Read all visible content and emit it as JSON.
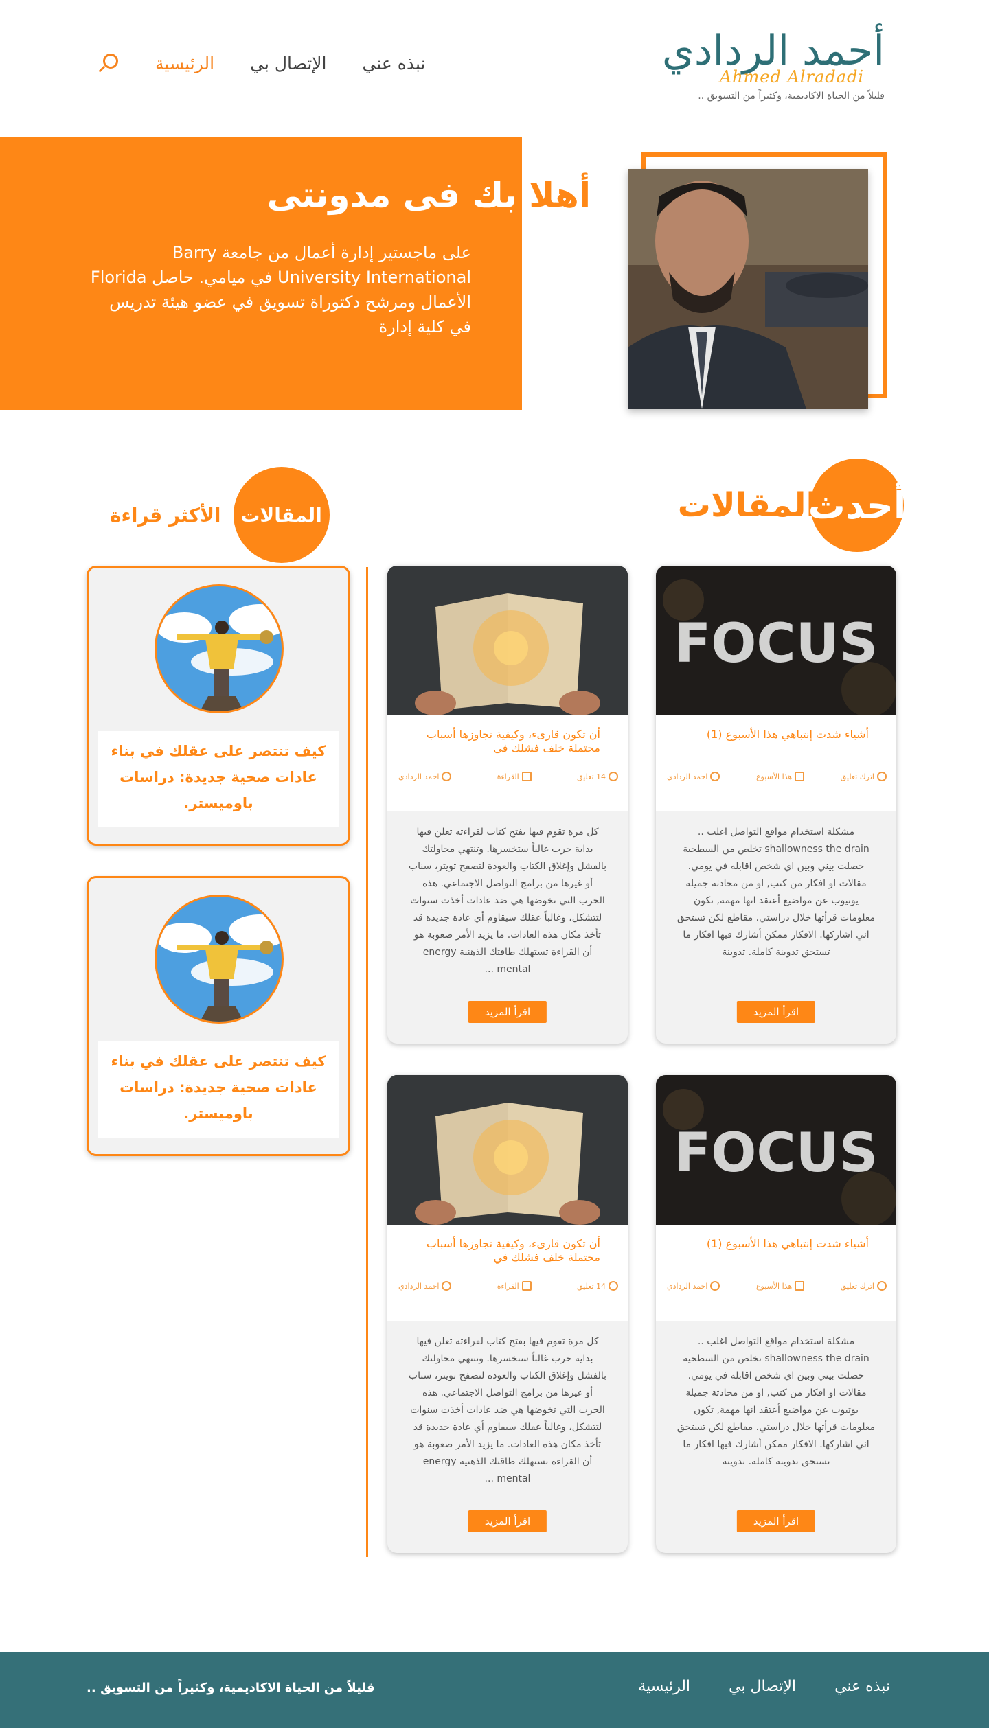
{
  "header": {
    "logo_ar": "أحمد الردادي",
    "logo_en": "Ahmed Alradadi",
    "tagline": "قليلاً من الحياة الاكاديمية، وكثيراً من التسويق .."
  },
  "nav": {
    "home": "الرئيسية",
    "contact": "الإتصال بي",
    "about": "نبذه عني",
    "search_icon": "search-icon"
  },
  "hero": {
    "title_word1": "أهلا",
    "title_rest": "بك فى مدونتى",
    "text": "على ماجستير إدارة أعمال من جامعة Barry University International في ميامي. حاصل Florida الأعمال ومرشح دكتوراة تسويق في عضو هيئة تدريس في كلية إدارة"
  },
  "latest": {
    "word1": "أحدث",
    "word2": "المقالات"
  },
  "popular": {
    "word1": "المقالات",
    "word2": "الأكثر قراءة"
  },
  "articles": [
    {
      "title": "أشياء شدت إنتباهي هذا الأسبوع (1)",
      "comments": "اترك تعليق",
      "category": "هذا الأسبوع",
      "author": "احمد الردادي",
      "excerpt": "مشكلة استخدام مواقع التواصل اغلب .. shallowness the drain تخلص من السطحية حصلت بيني وبين اي شخص اقابله في يومي. مقالات او افكار من كتب, او من محادثة جميلة يوتيوب عن مواضيع أعتقد انها مهمة, تكون معلومات قرأتها خلال دراستي. مقاطع لكن تستحق اني اشاركها. الافكار ممكن أشارك فيها افكار ما تستحق تدوينة كاملة. تدوينة",
      "more": "اقرأ المزيد"
    },
    {
      "title": "أن تكون قارىء، وكيفية تجاوزها أسباب محتملة خلف فشلك في",
      "comments": "14 تعليق",
      "category": "القراءة",
      "author": "احمد الردادي",
      "excerpt": "كل مرة تقوم فيها بفتح كتاب لقراءته تعلن فيها بداية حرب غالباً ستخسرها. وتنتهي محاولتك بالفشل وإغلاق الكتاب والعودة لتصفح تويتر، سناب أو غيرها من برامج التواصل الاجتماعي. هذه الحرب التي تخوضها هي ضد عادات أخذت سنوات لتتشكل، وغالباً عقلك سيقاوم أي عادة جديدة قد تأخذ مكان هذه العادات. ما يزيد الأمر صعوبة هو أن القراءة تستهلك طاقتك الذهنية energy mental ...",
      "more": "اقرأ المزيد"
    },
    {
      "title": "أشياء شدت إنتباهي هذا الأسبوع (1)",
      "comments": "اترك تعليق",
      "category": "هذا الأسبوع",
      "author": "احمد الردادي",
      "excerpt": "مشكلة استخدام مواقع التواصل اغلب .. shallowness the drain تخلص من السطحية حصلت بيني وبين اي شخص اقابله في يومي. مقالات او افكار من كتب, او من محادثة جميلة يوتيوب عن مواضيع أعتقد انها مهمة, تكون معلومات قرأتها خلال دراستي. مقاطع لكن تستحق اني اشاركها. الافكار ممكن أشارك فيها افكار ما تستحق تدوينة كاملة. تدوينة",
      "more": "اقرأ المزيد"
    },
    {
      "title": "أن تكون قارىء، وكيفية تجاوزها أسباب محتملة خلف فشلك في",
      "comments": "14 تعليق",
      "category": "القراءة",
      "author": "احمد الردادي",
      "excerpt": "كل مرة تقوم فيها بفتح كتاب لقراءته تعلن فيها بداية حرب غالباً ستخسرها. وتنتهي محاولتك بالفشل وإغلاق الكتاب والعودة لتصفح تويتر، سناب أو غيرها من برامج التواصل الاجتماعي. هذه الحرب التي تخوضها هي ضد عادات أخذت سنوات لتتشكل، وغالباً عقلك سيقاوم أي عادة جديدة قد تأخذ مكان هذه العادات. ما يزيد الأمر صعوبة هو أن القراءة تستهلك طاقتك الذهنية energy mental ...",
      "more": "اقرأ المزيد"
    }
  ],
  "popular_items": [
    {
      "title": "كيف تنتصر على عقلك في بناء عادات صحية جديدة: دراسات باوميستر."
    },
    {
      "title": "كيف تنتصر على عقلك في بناء عادات صحية جديدة: دراسات باوميستر."
    }
  ],
  "footer": {
    "tagline": "قليلاً من الحياة الاكاديمية، وكثيراً من التسويق ..",
    "about": "نبذه عني",
    "contact": "الإتصال بي",
    "home": "الرئيسية"
  },
  "colors": {
    "accent": "#fe8716",
    "teal": "#357078",
    "card_bg": "#f2f2f2"
  }
}
